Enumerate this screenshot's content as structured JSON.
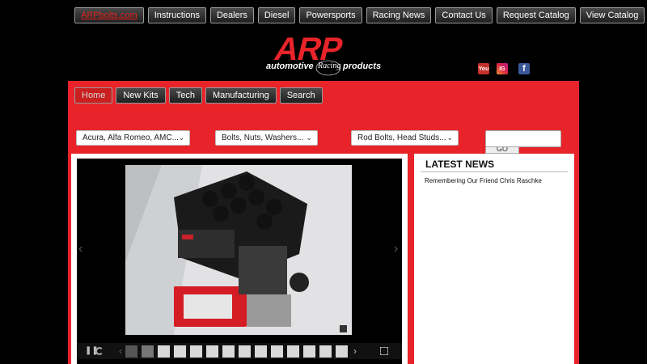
{
  "top_nav": {
    "items": [
      {
        "label": "ARPbolts.com"
      },
      {
        "label": "Instructions"
      },
      {
        "label": "Dealers"
      },
      {
        "label": "Diesel"
      },
      {
        "label": "Powersports"
      },
      {
        "label": "Racing News"
      },
      {
        "label": "Contact Us"
      },
      {
        "label": "Request Catalog"
      },
      {
        "label": "View Catalog"
      }
    ]
  },
  "logo": {
    "brand": "ARP",
    "tagline_left": "automotive",
    "tagline_script": "Racing",
    "tagline_right": "products"
  },
  "social": {
    "youtube": "You",
    "instagram": "IG",
    "facebook": "f"
  },
  "sub_nav": {
    "items": [
      {
        "label": "Home"
      },
      {
        "label": "New Kits"
      },
      {
        "label": "Tech"
      },
      {
        "label": "Manufacturing"
      },
      {
        "label": "Search"
      }
    ]
  },
  "filters": {
    "make": "Acura, Alfa Romeo, AMC...",
    "type": "Bolts, Nuts, Washers...",
    "application": "Rod Bolts, Head Studs...",
    "search_value": "",
    "go_label": "GO"
  },
  "news": {
    "title": "LATEST NEWS",
    "items": [
      "Remembering Our Friend Chris Raschke"
    ]
  },
  "colors": {
    "brand_red": "#e8242a",
    "nav_dark": "#2a2a2a",
    "black": "#000000"
  }
}
